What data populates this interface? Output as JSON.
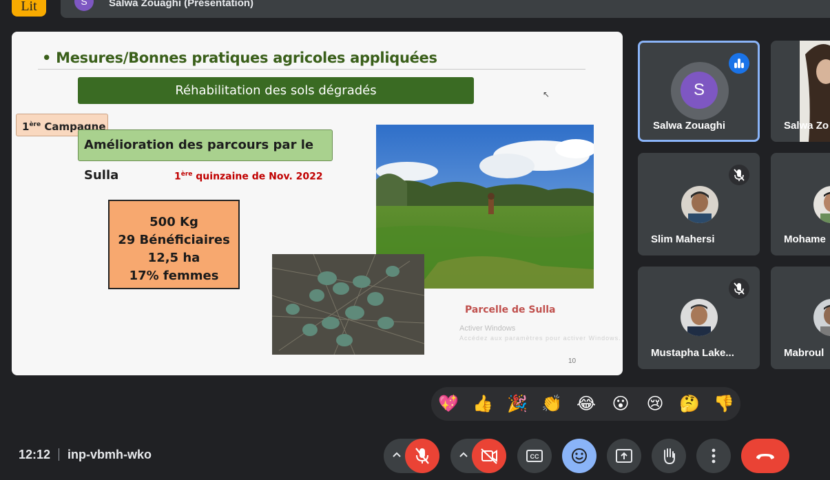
{
  "top_bar": {
    "logo_text": "Lit",
    "presenter_initial": "S",
    "presenter_label": "Salwa Zouaghi (Présentation)"
  },
  "slide": {
    "title": "• Mesures/Bonnes pratiques agricoles appliquées",
    "banner": "Réhabilitation des sols dégradés",
    "campaign_prefix": "1",
    "campaign_sup": "ère",
    "campaign_suffix": " Campagne",
    "subtitle": "Amélioration des parcours par le Sulla",
    "date_prefix": "1",
    "date_sup": "ère",
    "date_suffix": " quinzaine de Nov. 2022",
    "stats": [
      "500 Kg",
      "29 Bénéficiaires",
      "12,5 ha",
      "17% femmes"
    ],
    "caption": "Parcelle de Sulla",
    "watermark": "Activer Windows",
    "watermark_sub": "Accédez aux paramètres pour activer Windows.",
    "page_number": "10"
  },
  "participants": [
    {
      "name": "Salwa Zouaghi",
      "initial": "S",
      "state": "speaking"
    },
    {
      "name": "Salwa Zo",
      "state": "video"
    },
    {
      "name": "Slim Mahersi",
      "state": "muted"
    },
    {
      "name": "Mohame",
      "state": "video"
    },
    {
      "name": "Mustapha Lake...",
      "state": "muted"
    },
    {
      "name": "Mabroul",
      "state": "video"
    }
  ],
  "reactions": [
    "💖",
    "👍",
    "🎉",
    "👏",
    "😂",
    "😮",
    "😢",
    "🤔",
    "👎"
  ],
  "meeting": {
    "time": "12:12",
    "code": "inp-vbmh-wko"
  },
  "colors": {
    "background": "#202124",
    "tile": "#3c4043",
    "accent_blue": "#8ab4f8",
    "end_call_red": "#ea4335",
    "avatar_purple": "#7e57c2"
  },
  "controls": [
    "mic-options",
    "mic-off",
    "camera-options",
    "camera-off",
    "captions",
    "reactions",
    "present-now",
    "raise-hand",
    "more-options",
    "leave-call"
  ]
}
